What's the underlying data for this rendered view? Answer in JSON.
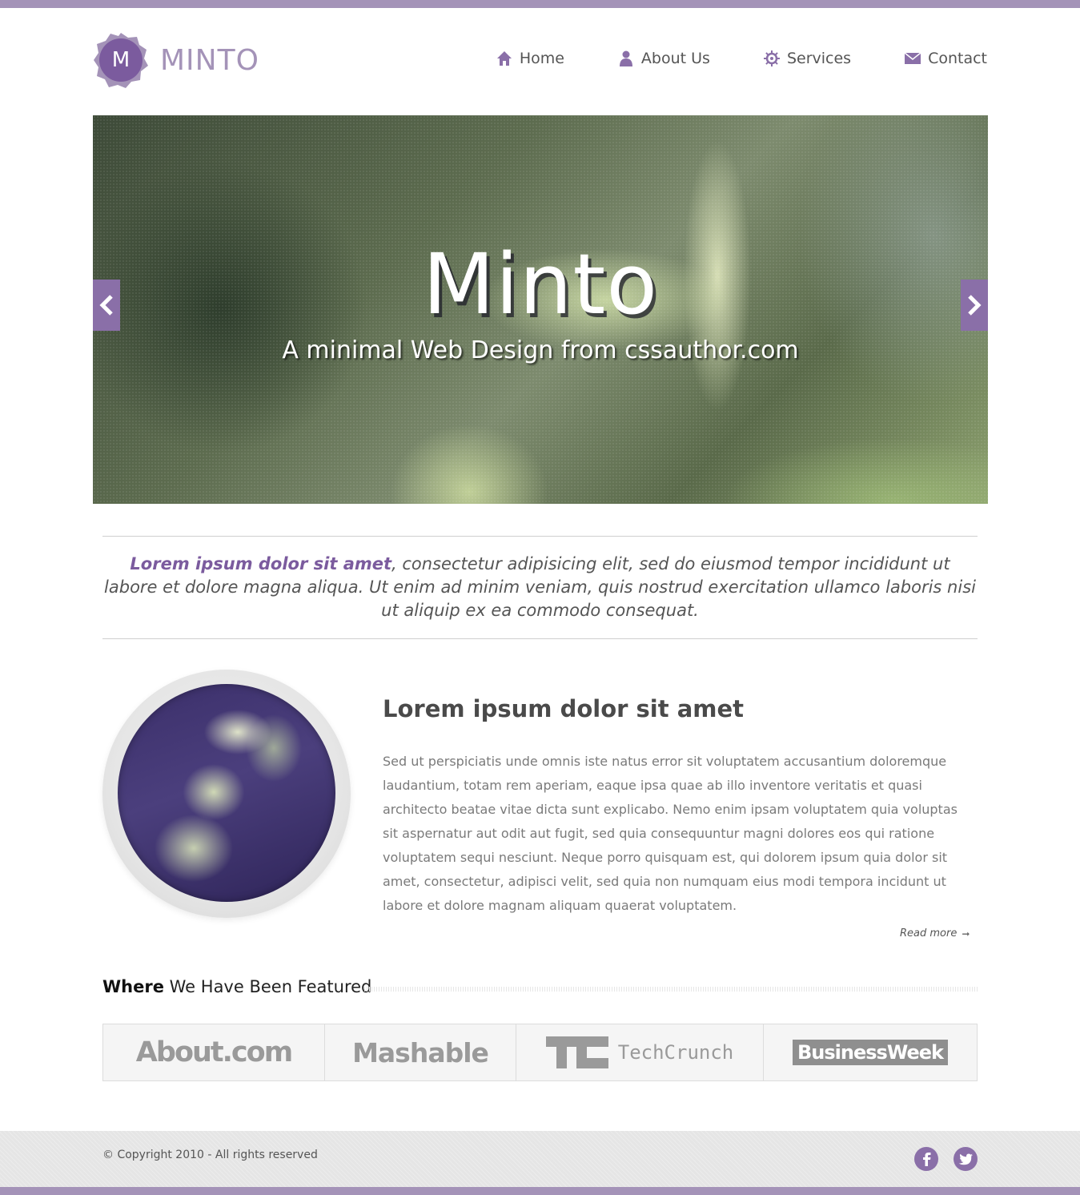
{
  "colors": {
    "accent": "#8a6fa8",
    "accent_light": "#a493b8",
    "text": "#444444",
    "footer_bg": "#e5e5e5"
  },
  "header": {
    "logo_letter": "M",
    "logo_text": "MINTO",
    "nav": [
      {
        "label": "Home",
        "icon": "home-icon"
      },
      {
        "label": "About Us",
        "icon": "user-icon"
      },
      {
        "label": "Services",
        "icon": "gear-icon"
      },
      {
        "label": "Contact",
        "icon": "envelope-icon"
      }
    ]
  },
  "slider": {
    "title": "Minto",
    "subtitle": "A minimal Web Design from cssauthor.com",
    "prev_icon": "chevron-left-icon",
    "next_icon": "chevron-right-icon"
  },
  "intro": {
    "highlight": "Lorem ipsum dolor sit amet",
    "text": ", consectetur adipisicing elit, sed do eiusmod tempor incididunt ut labore et dolore magna aliqua. Ut enim ad minim veniam, quis nostrud exercitation ullamco laboris nisi ut aliquip ex ea commodo consequat."
  },
  "feature": {
    "title": "Lorem ipsum dolor sit amet",
    "body": "Sed ut perspiciatis unde omnis iste natus error sit voluptatem accusantium doloremque laudantium, totam rem aperiam, eaque ipsa quae ab illo inventore veritatis et quasi architecto beatae vitae dicta sunt explicabo. Nemo enim ipsam voluptatem quia voluptas sit aspernatur aut odit aut fugit, sed quia consequuntur magni dolores eos qui ratione voluptatem sequi nesciunt. Neque porro quisquam est, qui dolorem ipsum quia dolor sit amet, consectetur, adipisci velit, sed quia non numquam eius modi tempora incidunt ut labore et dolore magnam aliquam quaerat voluptatem.",
    "read_more": "Read more",
    "read_more_arrow": "➞"
  },
  "featured": {
    "heading_strong": "Where",
    "heading_rest": " We Have Been Featured",
    "logos": {
      "about": "About.com",
      "mashable": "Mashable",
      "techcrunch": "TechCrunch",
      "businessweek": "BusinessWeek"
    }
  },
  "footer": {
    "copyright": "© Copyright 2010 - All rights reserved",
    "social": [
      "facebook-icon",
      "twitter-icon"
    ]
  }
}
